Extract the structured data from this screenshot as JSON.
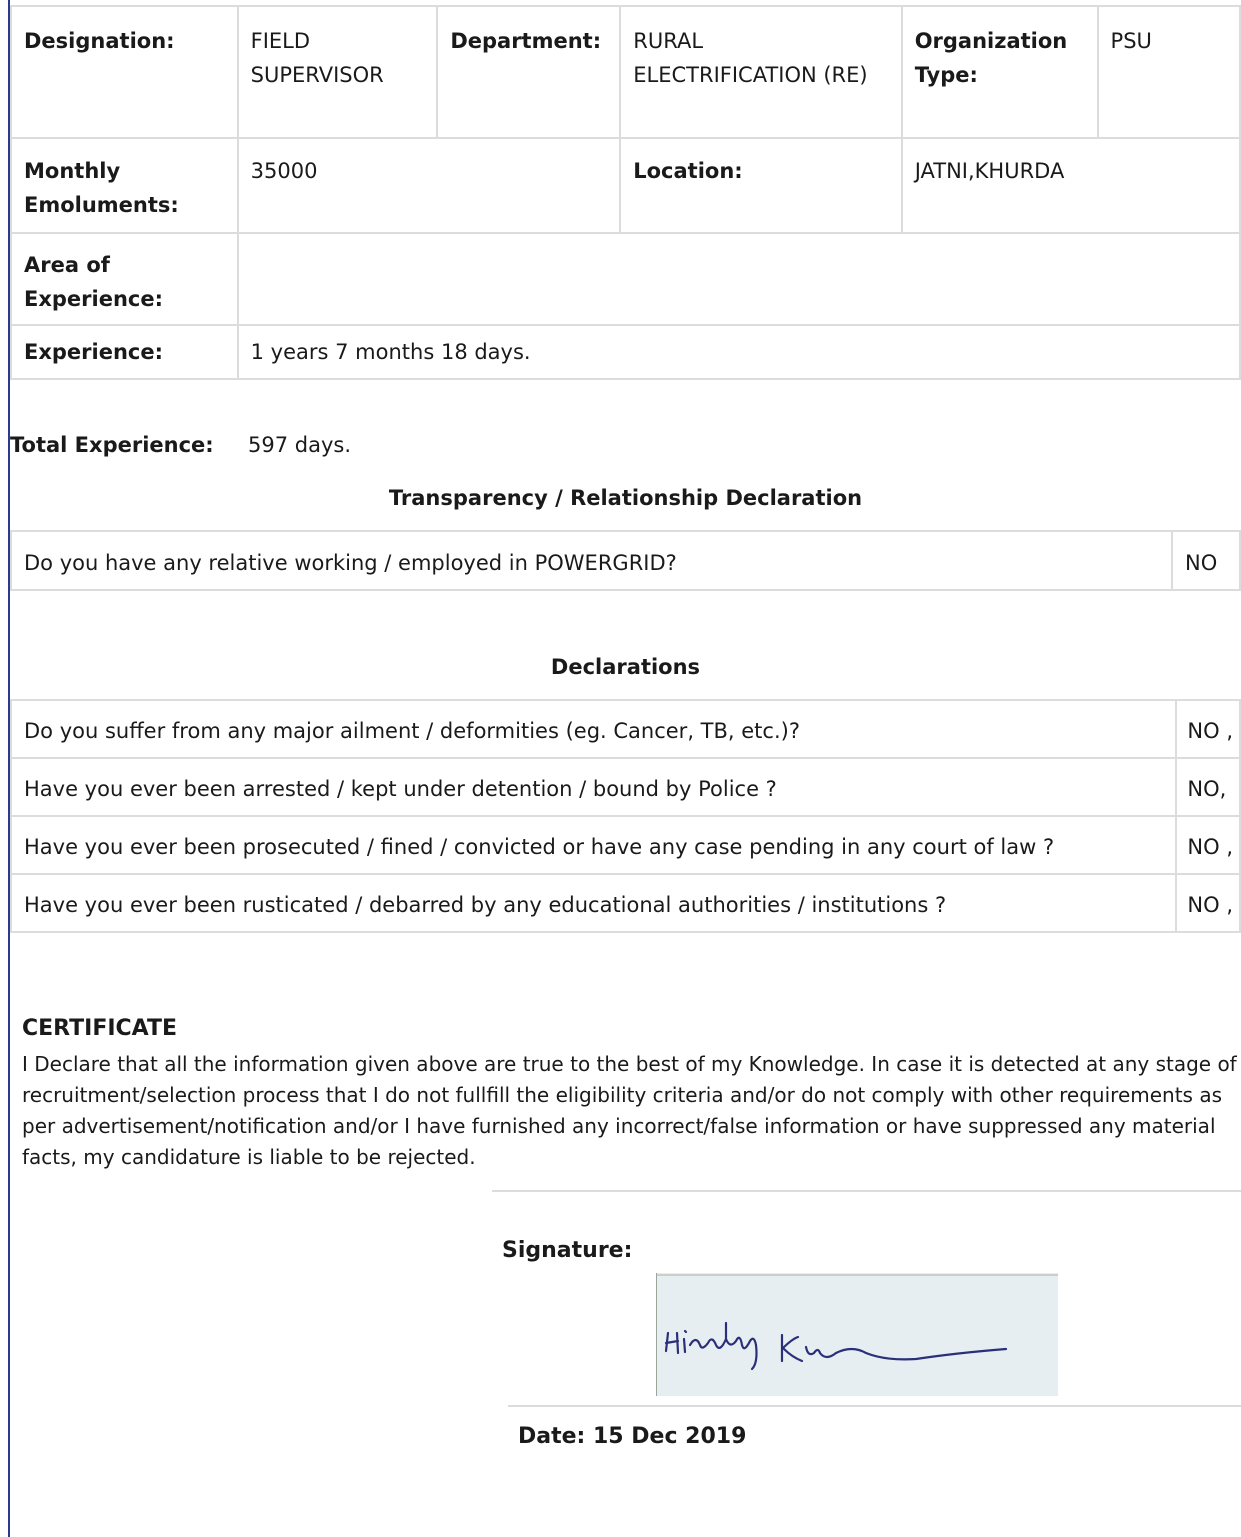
{
  "employment": {
    "designation_label": "Designation:",
    "designation_value": "FIELD SUPERVISOR",
    "department_label": "Department:",
    "department_value": "RURAL ELECTRIFICATION (RE)",
    "org_type_label": "Organization Type:",
    "org_type_value": "PSU",
    "emoluments_label": "Monthly Emoluments:",
    "emoluments_value": "35000",
    "location_label": "Location:",
    "location_value": "JATNI,KHURDA",
    "area_label": "Area of Experience:",
    "area_value": "",
    "experience_label": "Experience:",
    "experience_value": "1 years 7 months 18 days."
  },
  "total": {
    "label": "Total Experience:",
    "value": "597 days."
  },
  "transparency": {
    "heading": "Transparency / Relationship Declaration",
    "question": "Do you have any relative working / employed in POWERGRID?",
    "answer": "NO"
  },
  "declarations": {
    "heading": "Declarations",
    "items": [
      {
        "question": "Do you suffer from any major ailment / deformities (eg. Cancer, TB, etc.)?",
        "answer": "NO ,"
      },
      {
        "question": "Have you ever been arrested / kept under detention / bound by Police ?",
        "answer": "NO,"
      },
      {
        "question": "Have you ever been prosecuted / fined / convicted or have any case pending in any court of law ?",
        "answer": "NO ,"
      },
      {
        "question": "Have you ever been rusticated / debarred by any educational authorities / institutions ?",
        "answer": "NO ,"
      }
    ]
  },
  "certificate": {
    "title": "CERTIFICATE",
    "text": "I Declare that all the information given above are true to the best of my Knowledge. In case it is detected at any stage of recruitment/selection process that I do not fullfill the eligibility criteria and/or do not comply with other requirements as per advertisement/notification and/or I have furnished any incorrect/false information or have suppressed any material facts, my candidature is liable to be rejected."
  },
  "signature": {
    "label": "Signature:",
    "handwritten": "Hitendra Kumar"
  },
  "date": "Date: 15 Dec 2019"
}
